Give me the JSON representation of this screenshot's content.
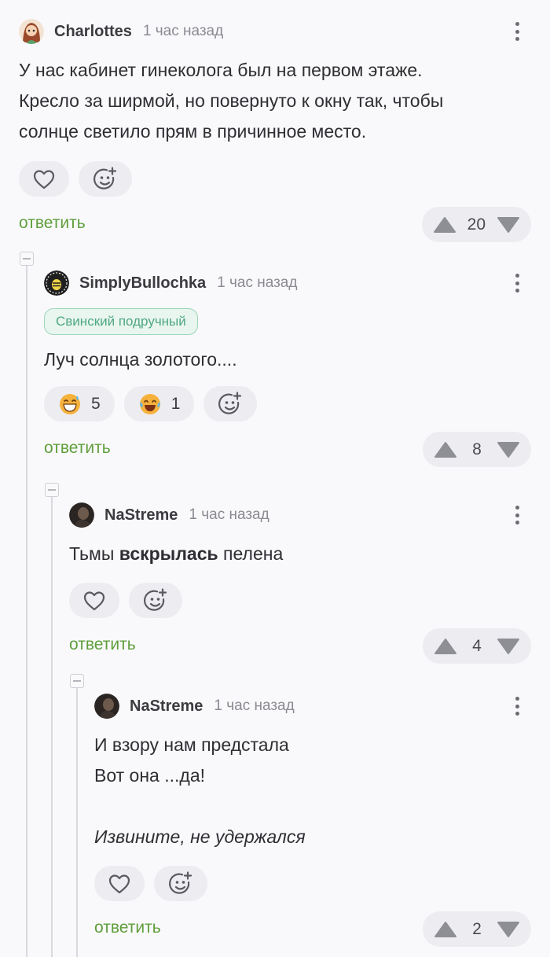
{
  "comments": [
    {
      "author": "Charlottes",
      "time": "1 час назад",
      "lines": [
        "У нас кабинет гинеколога был на первом этаже.",
        "Кресло за ширмой, но повернуто к окну так, чтобы",
        "солнце светило прям в причинное место."
      ],
      "reply_label": "ответить",
      "rating": "20"
    },
    {
      "author": "SimplyBullochka",
      "time": "1 час назад",
      "badge": "Свинский подручный",
      "lines": [
        "Луч солнца золотого...."
      ],
      "reactions": [
        {
          "icon": "grinning-sweat-emoji",
          "count": "5"
        },
        {
          "icon": "tears-of-joy-emoji",
          "count": "1"
        }
      ],
      "reply_label": "ответить",
      "rating": "8"
    },
    {
      "author": "NaStreme",
      "time": "1 час назад",
      "text_pre": "Тьмы ",
      "text_bold": "вскрылась",
      "text_post": " пелена",
      "reply_label": "ответить",
      "rating": "4"
    },
    {
      "author": "NaStreme",
      "time": "1 час назад",
      "lines": [
        "И взору нам предстала",
        "Вот она ...да!",
        ""
      ],
      "italic_line": "Извините, не удержался",
      "reply_label": "ответить",
      "rating": "2"
    }
  ]
}
